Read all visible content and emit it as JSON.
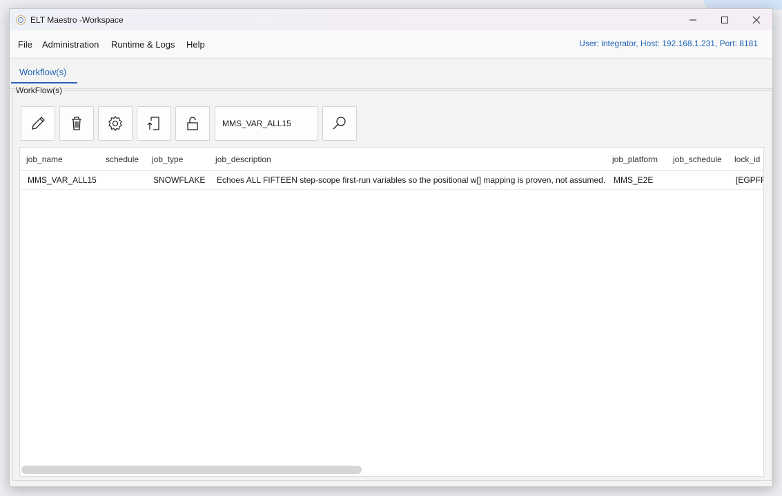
{
  "window": {
    "title": "ELT Maestro -Workspace"
  },
  "menu": [
    "File",
    "Administration",
    "Runtime & Logs",
    "Help"
  ],
  "connection_info": "User: integrator, Host: 192.168.1.231, Port: 8181",
  "tabs": [
    {
      "label": "Workflow(s)",
      "active": true
    }
  ],
  "group": {
    "label": "WorkFlow(s)"
  },
  "toolbar": {
    "buttons": [
      "edit-icon",
      "trash-icon",
      "gear-icon",
      "import-icon",
      "unlock-icon",
      "search-icon"
    ],
    "search_value": "MMS_VAR_ALL15"
  },
  "table": {
    "columns": [
      "job_name",
      "schedule",
      "job_type",
      "job_description",
      "job_platform",
      "job_schedule",
      "lock_id"
    ],
    "rows": [
      {
        "job_name": "MMS_VAR_ALL15",
        "schedule": "",
        "job_type": "SNOWFLAKE",
        "job_description": "Echoes ALL FIFTEEN step-scope first-run variables so the positional w[] mapping is proven, not assumed.",
        "job_platform": "MMS_E2E",
        "job_schedule": "",
        "lock_id": "[EGPFF("
      }
    ]
  },
  "colors": {
    "accent": "#1f62b5",
    "titlebar": "#f1eef6"
  }
}
